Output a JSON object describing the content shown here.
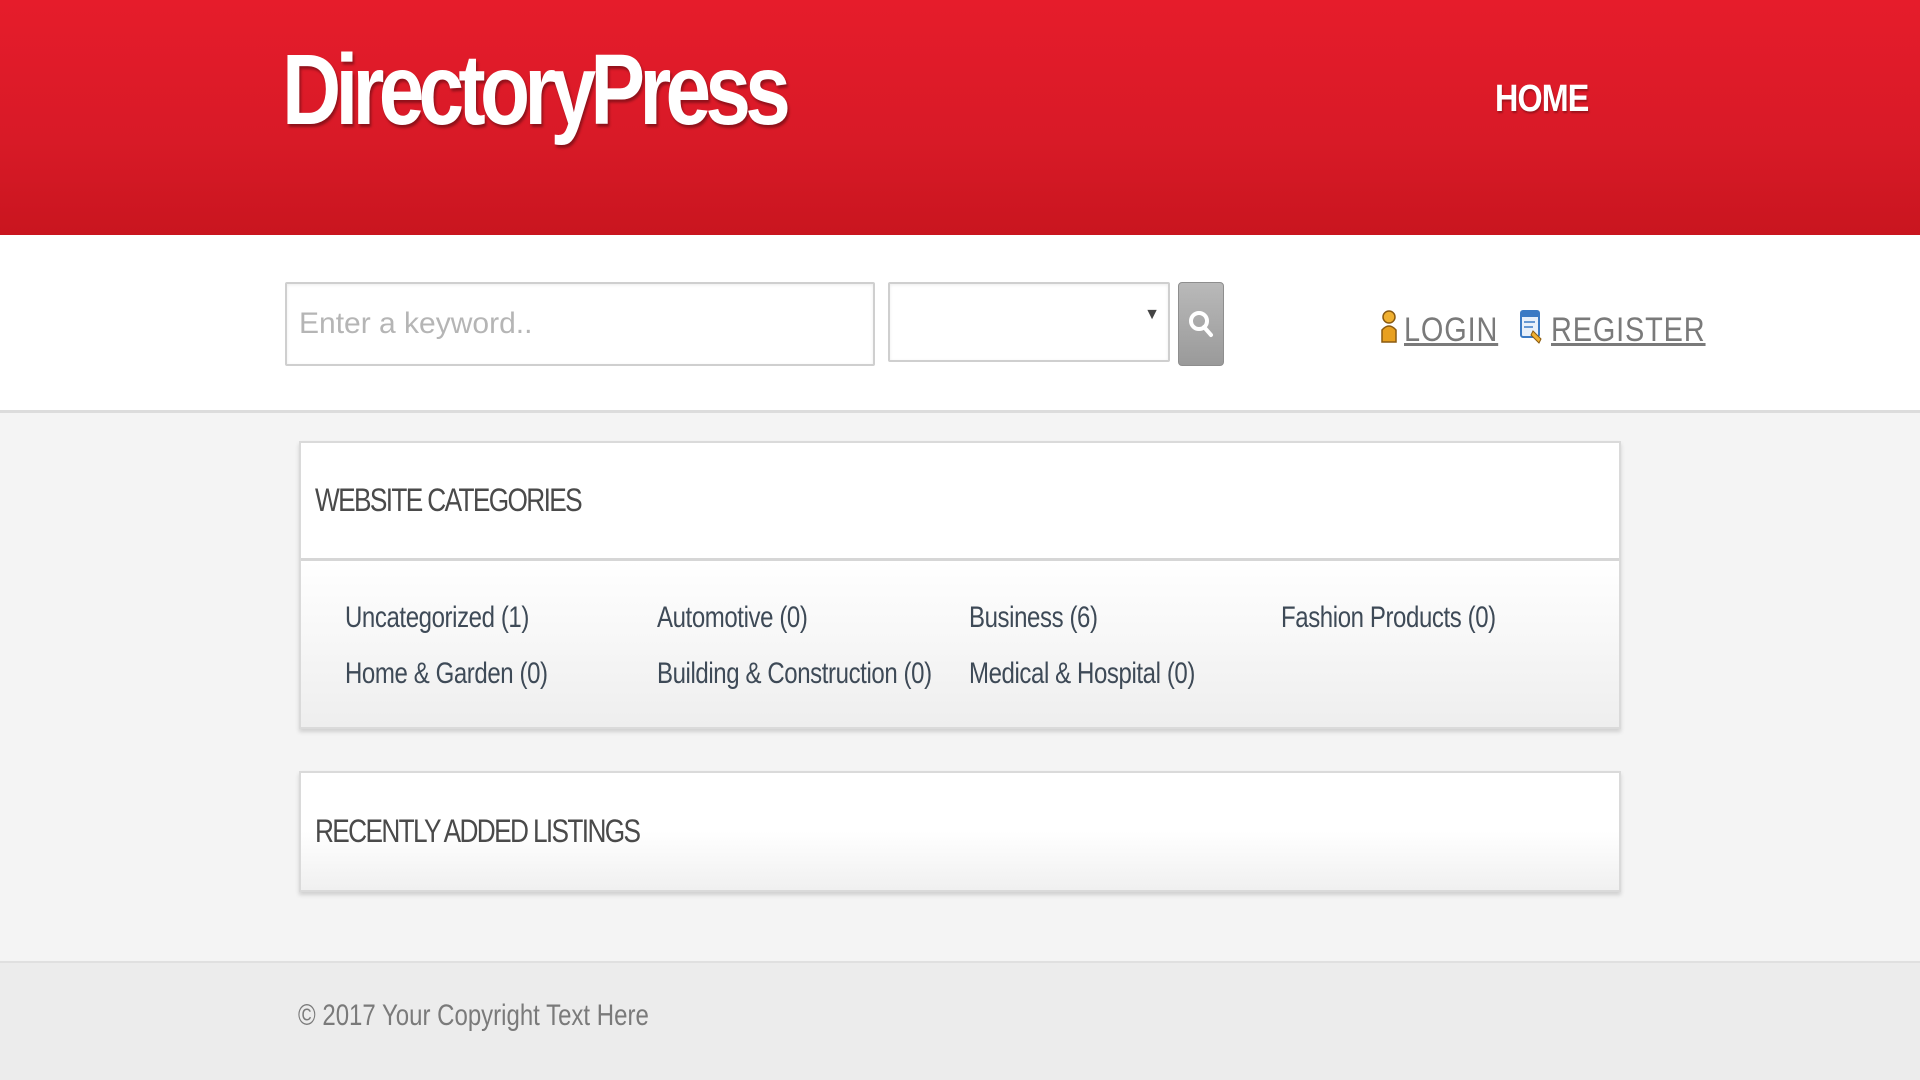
{
  "header": {
    "logo_text": "DirectoryPress",
    "nav": {
      "home_label": "HOME"
    }
  },
  "search": {
    "keyword_placeholder": "Enter a keyword..",
    "keyword_value": "",
    "category_selected": ""
  },
  "auth": {
    "login_label": "LOGIN",
    "register_label": "REGISTER"
  },
  "categories_panel": {
    "title": "WEBSITE CATEGORIES",
    "items": [
      {
        "label": "Uncategorized (1)"
      },
      {
        "label": "Automotive (0)"
      },
      {
        "label": "Business (6)"
      },
      {
        "label": "Fashion Products (0)"
      },
      {
        "label": "Home & Garden (0)"
      },
      {
        "label": "Building & Construction (0)"
      },
      {
        "label": "Medical & Hospital (0)"
      }
    ]
  },
  "recent_panel": {
    "title": "RECENTLY ADDED LISTINGS"
  },
  "footer": {
    "copyright": "© 2017 Your Copyright Text Here"
  },
  "colors": {
    "brand_red": "#e31c2a",
    "link_gray": "#7a7a7a",
    "category_text": "#3e4a57"
  },
  "icons": {
    "search_button": "search-icon",
    "login": "user-icon",
    "register": "register-icon",
    "select_caret": "caret-down-icon"
  }
}
